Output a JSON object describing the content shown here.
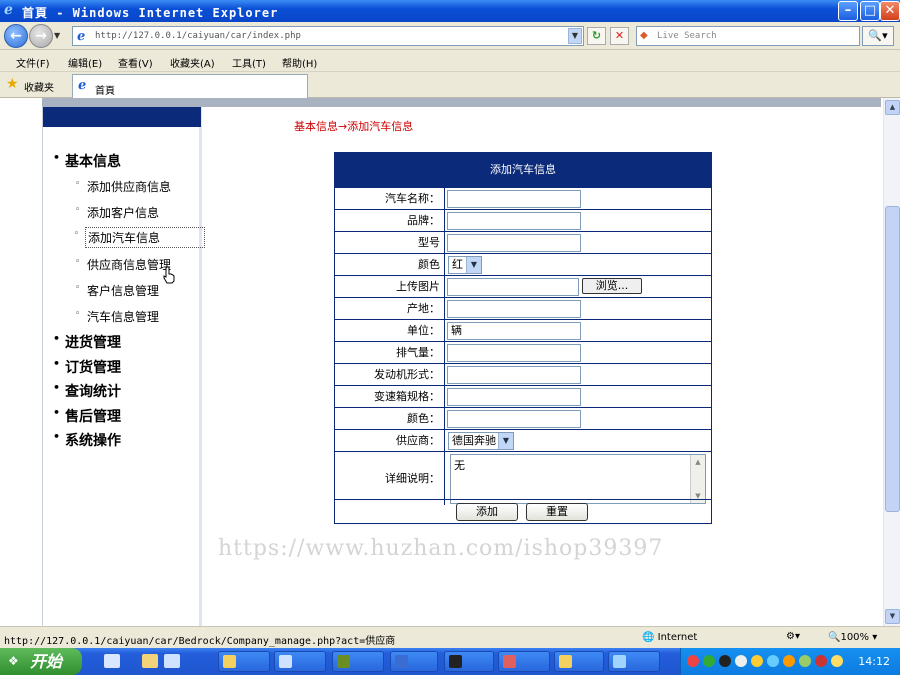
{
  "window": {
    "title": "首頁 - Windows Internet Explorer"
  },
  "address_bar": {
    "url": "http://127.0.0.1/caiyuan/car/index.php",
    "search_placeholder": "Live Search"
  },
  "menu": [
    "文件(F)",
    "编辑(E)",
    "查看(V)",
    "收藏夹(A)",
    "工具(T)",
    "帮助(H)"
  ],
  "favorites": {
    "label": "收藏夹",
    "tab_title": "首頁"
  },
  "breadcrumb": "基本信息→添加汽车信息",
  "sidebar": {
    "categories": [
      "基本信息",
      "进货管理",
      "订货管理",
      "查询统计",
      "售后管理",
      "系统操作"
    ],
    "sub_items": [
      "添加供应商信息",
      "添加客户信息",
      "添加汽车信息",
      "供应商信息管理",
      "客户信息管理",
      "汽车信息管理"
    ]
  },
  "form": {
    "header": "添加汽车信息",
    "labels": {
      "car_name": "汽车名称：",
      "brand": "品牌：",
      "model": "型号",
      "color1": "颜色",
      "upload": "上传图片",
      "origin": "产地：",
      "unit": "单位：",
      "displacement": "排气量：",
      "engine": "发动机形式：",
      "gearbox": "变速箱规格：",
      "color2": "颜色：",
      "supplier": "供应商：",
      "description": "详细说明："
    },
    "values": {
      "color1": "红",
      "unit": "辆",
      "supplier": "德国奔驰",
      "description": "无"
    },
    "browse_label": "浏览...",
    "add_label": "添加",
    "reset_label": "重置"
  },
  "watermark": "https://www.huzhan.com/ishop39397",
  "statusbar": {
    "text": "http://127.0.0.1/caiyuan/car/Bedrock/Company_manage.php?act=供应商",
    "zone": "Internet",
    "zoom": "100%"
  },
  "taskbar": {
    "start": "开始",
    "clock": "14:12"
  }
}
